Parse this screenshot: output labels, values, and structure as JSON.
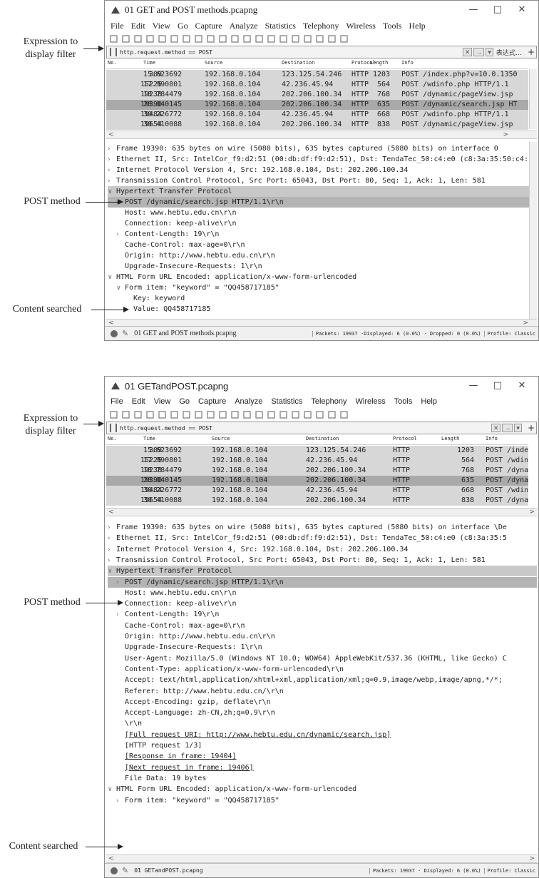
{
  "callouts": {
    "expression_filter": [
      "Expression to",
      "display filter"
    ],
    "post_method": "POST method",
    "content_searched": "Content searched"
  },
  "win1": {
    "title": "01 GET and POST methods.pcapng",
    "controls": [
      "—",
      "□",
      "✕"
    ],
    "menu": [
      "File",
      "Edit",
      "View",
      "Go",
      "Capture",
      "Analyze",
      "Statistics",
      "Telephony",
      "Wireless",
      "Tools",
      "Help"
    ],
    "filter": {
      "text": "http.request.method == POST",
      "expression_label": "表达式…",
      "plus": "+"
    },
    "columns": [
      "No.",
      "Time",
      "Source",
      "Destination",
      "Protocol",
      "Length",
      "Info"
    ],
    "packets": [
      {
        "no": "309",
        "time": "15.623692",
        "src": "192.168.0.104",
        "dst": "123.125.54.246",
        "proto": "HTTP",
        "len": "1203",
        "info": "POST /index.php?v=10.0.1350"
      },
      {
        "no": "15225",
        "time": "17.990801",
        "src": "192.168.0.104",
        "dst": "42.236.45.94",
        "proto": "HTTP",
        "len": "564",
        "info": "POST /wdinfo.php HTTP/1.1"
      },
      {
        "no": "19238",
        "time": "18.784479",
        "src": "192.168.0.104",
        "dst": "202.206.100.34",
        "proto": "HTTP",
        "len": "768",
        "info": "POST /dynamic/pageView.jsp"
      },
      {
        "no": "19390",
        "time": "28.040145",
        "src": "192.168.0.104",
        "dst": "202.206.100.34",
        "proto": "HTTP",
        "len": "635",
        "info": "POST /dynamic/search.jsp HT"
      },
      {
        "no": "19484",
        "time": "30.226772",
        "src": "192.168.0.104",
        "dst": "42.236.45.94",
        "proto": "HTTP",
        "len": "668",
        "info": "POST /wdinfo.php HTTP/1.1"
      },
      {
        "no": "19654",
        "time": "30.410088",
        "src": "192.168.0.104",
        "dst": "202.206.100.34",
        "proto": "HTTP",
        "len": "838",
        "info": "POST /dynamic/pageView.jsp"
      }
    ],
    "details": [
      {
        "indent": 0,
        "tri": "›",
        "text": "Frame 19390: 635 bytes on wire (5080 bits), 635 bytes captured (5080 bits) on interface 0"
      },
      {
        "indent": 0,
        "tri": "›",
        "text": "Ethernet II, Src: IntelCor_f9:d2:51 (00:db:df:f9:d2:51), Dst: TendaTec_50:c4:e0 (c8:3a:35:50:c4:"
      },
      {
        "indent": 0,
        "tri": "›",
        "text": "Internet Protocol Version 4, Src: 192.168.0.104, Dst: 202.206.100.34"
      },
      {
        "indent": 0,
        "tri": "›",
        "text": "Transmission Control Protocol, Src Port: 65043, Dst Port: 80, Seq: 1, Ack: 1, Len: 581"
      },
      {
        "indent": 0,
        "tri": "∨",
        "text": "Hypertext Transfer Protocol"
      },
      {
        "indent": 1,
        "tri": "›",
        "text": "POST /dynamic/search.jsp HTTP/1.1\\r\\n"
      },
      {
        "indent": 1,
        "tri": "",
        "text": "Host: www.hebtu.edu.cn\\r\\n"
      },
      {
        "indent": 1,
        "tri": "",
        "text": "Connection: keep-alive\\r\\n"
      },
      {
        "indent": 1,
        "tri": "›",
        "text": "Content-Length: 19\\r\\n"
      },
      {
        "indent": 1,
        "tri": "",
        "text": "Cache-Control: max-age=0\\r\\n"
      },
      {
        "indent": 1,
        "tri": "",
        "text": "Origin: http://www.hebtu.edu.cn\\r\\n"
      },
      {
        "indent": 1,
        "tri": "",
        "text": "Upgrade-Insecure-Requests: 1\\r\\n"
      },
      {
        "indent": 0,
        "tri": "∨",
        "text": "HTML Form URL Encoded: application/x-www-form-urlencoded"
      },
      {
        "indent": 1,
        "tri": "∨",
        "text": "Form item: \"keyword\" = \"QQ458717185\""
      },
      {
        "indent": 2,
        "tri": "",
        "text": "Key: keyword"
      },
      {
        "indent": 2,
        "tri": "",
        "text": "Value: QQ458717185"
      }
    ],
    "status": {
      "file": "01 GET and POST methods.pcapng",
      "packets": "Packets: 19937",
      "displayed": "·Displayed: 6 (0.0%)",
      "dropped": "· Dropped: 0 (0.0%)",
      "profile": "Profile: Classic"
    }
  },
  "win2": {
    "title": "01 GETandPOST.pcapng",
    "controls": [
      "—",
      "□",
      "✕"
    ],
    "menu": [
      "File",
      "Edit",
      "View",
      "Go",
      "Capture",
      "Analyze",
      "Statistics",
      "Telephony",
      "Wireless",
      "Tools",
      "Help"
    ],
    "filter": {
      "text": "http.request.method == POST",
      "plus": "+"
    },
    "columns": [
      "No.",
      "Time",
      "Source",
      "Destination",
      "Protocol",
      "Length",
      "Info"
    ],
    "packets": [
      {
        "no": "309",
        "time": "15.623692",
        "src": "192.168.0.104",
        "dst": "123.125.54.246",
        "proto": "HTTP",
        "len": "1203",
        "info": "POST /index.php?v="
      },
      {
        "no": "15225",
        "time": "17.990801",
        "src": "192.168.0.104",
        "dst": "42.236.45.94",
        "proto": "HTTP",
        "len": "564",
        "info": "POST /wdinfo.php H"
      },
      {
        "no": "19238",
        "time": "18.784479",
        "src": "192.168.0.104",
        "dst": "202.206.100.34",
        "proto": "HTTP",
        "len": "768",
        "info": "POST /dynamic/page"
      },
      {
        "no": "19390",
        "time": "28.040145",
        "src": "192.168.0.104",
        "dst": "202.206.100.34",
        "proto": "HTTP",
        "len": "635",
        "info": "POST /dynamic/sear"
      },
      {
        "no": "19484",
        "time": "30.226772",
        "src": "192.168.0.104",
        "dst": "42.236.45.94",
        "proto": "HTTP",
        "len": "668",
        "info": "POST /wdinfo.php H"
      },
      {
        "no": "19654",
        "time": "30.410088",
        "src": "192.168.0.104",
        "dst": "202.206.100.34",
        "proto": "HTTP",
        "len": "838",
        "info": "POST /dynamic/page"
      }
    ],
    "details": [
      {
        "indent": 0,
        "tri": "›",
        "text": "Frame 19390: 635 bytes on wire (5080 bits), 635 bytes captured (5080 bits) on interface \\De"
      },
      {
        "indent": 0,
        "tri": "›",
        "text": "Ethernet II, Src: IntelCor_f9:d2:51 (00:db:df:f9:d2:51), Dst: TendaTec_50:c4:e0 (c8:3a:35:5"
      },
      {
        "indent": 0,
        "tri": "›",
        "text": "Internet Protocol Version 4, Src: 192.168.0.104, Dst: 202.206.100.34"
      },
      {
        "indent": 0,
        "tri": "›",
        "text": "Transmission Control Protocol, Src Port: 65043, Dst Port: 80, Seq: 1, Ack: 1, Len: 581"
      },
      {
        "indent": 0,
        "tri": "∨",
        "text": "Hypertext Transfer Protocol"
      },
      {
        "indent": 1,
        "tri": "›",
        "text": "POST /dynamic/search.jsp HTTP/1.1\\r\\n"
      },
      {
        "indent": 1,
        "tri": "",
        "text": "Host: www.hebtu.edu.cn\\r\\n"
      },
      {
        "indent": 1,
        "tri": "",
        "text": "Connection: keep-alive\\r\\n"
      },
      {
        "indent": 1,
        "tri": "›",
        "text": "Content-Length: 19\\r\\n"
      },
      {
        "indent": 1,
        "tri": "",
        "text": "Cache-Control: max-age=0\\r\\n"
      },
      {
        "indent": 1,
        "tri": "",
        "text": "Origin: http://www.hebtu.edu.cn\\r\\n"
      },
      {
        "indent": 1,
        "tri": "",
        "text": "Upgrade-Insecure-Requests: 1\\r\\n"
      },
      {
        "indent": 1,
        "tri": "",
        "text": "User-Agent: Mozilla/5.0 (Windows NT 10.0; WOW64) AppleWebKit/537.36 (KHTML, like Gecko) C"
      },
      {
        "indent": 1,
        "tri": "",
        "text": "Content-Type: application/x-www-form-urlencoded\\r\\n"
      },
      {
        "indent": 1,
        "tri": "",
        "text": "Accept: text/html,application/xhtml+xml,application/xml;q=0.9,image/webp,image/apng,*/*;"
      },
      {
        "indent": 1,
        "tri": "",
        "text": "Referer: http://www.hebtu.edu.cn/\\r\\n"
      },
      {
        "indent": 1,
        "tri": "",
        "text": "Accept-Encoding: gzip, deflate\\r\\n"
      },
      {
        "indent": 1,
        "tri": "",
        "text": "Accept-Language: zh-CN,zh;q=0.9\\r\\n"
      },
      {
        "indent": 1,
        "tri": "",
        "text": "\\r\\n"
      },
      {
        "indent": 1,
        "tri": "",
        "link": true,
        "text": "[Full request URI: http://www.hebtu.edu.cn/dynamic/search.jsp]"
      },
      {
        "indent": 1,
        "tri": "",
        "text": "[HTTP request 1/3]"
      },
      {
        "indent": 1,
        "tri": "",
        "link": true,
        "text": "[Response in frame: 19404]"
      },
      {
        "indent": 1,
        "tri": "",
        "link": true,
        "text": "[Next request in frame: 19406]"
      },
      {
        "indent": 1,
        "tri": "",
        "text": "File Data: 19 bytes"
      },
      {
        "indent": 0,
        "tri": "∨",
        "text": "HTML Form URL Encoded: application/x-www-form-urlencoded"
      },
      {
        "indent": 1,
        "tri": "›",
        "text": "Form item: \"keyword\" = \"QQ458717185\""
      }
    ],
    "status": {
      "file": "01 GETandPOST.pcapng",
      "packets": "Packets: 19937",
      "displayed": "· Displayed: 6 (0.0%)",
      "profile": "Profile: Classic"
    }
  },
  "scroll_arrows": {
    "left": "<",
    "right": ">"
  },
  "icons": {
    "status_indicator": "ready-indicator",
    "edit_note": "edit-icon"
  },
  "colors": {
    "row_bg": "#d7d7d7",
    "row_selected": "#a9a9a9",
    "detail_highlight": "#c8c8c8"
  }
}
